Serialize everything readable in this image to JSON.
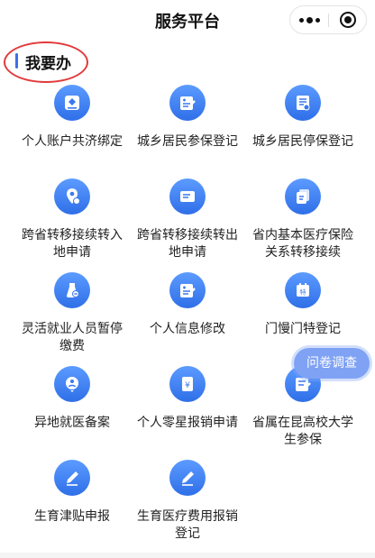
{
  "header": {
    "title": "服务平台"
  },
  "section": {
    "title": "我要办"
  },
  "survey_label": "问卷调查",
  "theme": {
    "accent": "#3b6fe6",
    "annotation": "#e23a3a"
  },
  "items": [
    {
      "label": "个人账户共济绑定",
      "icon": "account-binding-icon"
    },
    {
      "label": "城乡居民参保登记",
      "icon": "register-form-icon"
    },
    {
      "label": "城乡居民停保登记",
      "icon": "stop-insurance-icon"
    },
    {
      "label": "跨省转移接续转入地申请",
      "icon": "location-transfer-icon"
    },
    {
      "label": "跨省转移接续转出地申请",
      "icon": "transfer-out-card-icon"
    },
    {
      "label": "省内基本医疗保险关系转移接续",
      "icon": "transfer-copy-icon"
    },
    {
      "label": "灵活就业人员暂停缴费",
      "icon": "pause-payment-icon"
    },
    {
      "label": "个人信息修改",
      "icon": "edit-info-icon"
    },
    {
      "label": "门慢门特登记",
      "icon": "calendar-special-icon"
    },
    {
      "label": "异地就医备案",
      "icon": "remote-medical-icon"
    },
    {
      "label": "个人零星报销申请",
      "icon": "reimbursement-icon"
    },
    {
      "label": "省属在昆高校大学生参保",
      "icon": "student-insurance-icon"
    },
    {
      "label": "生育津贴申报",
      "icon": "pen-icon"
    },
    {
      "label": "生育医疗费用报销登记",
      "icon": "pen-icon"
    }
  ]
}
